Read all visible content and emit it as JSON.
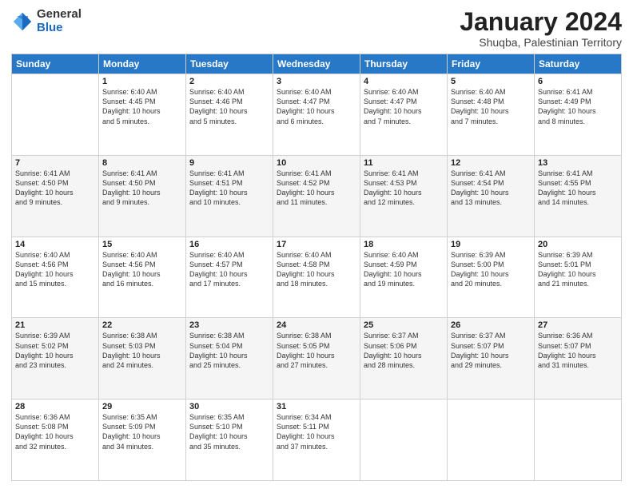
{
  "logo": {
    "general": "General",
    "blue": "Blue"
  },
  "title": "January 2024",
  "subtitle": "Shuqba, Palestinian Territory",
  "columns": [
    "Sunday",
    "Monday",
    "Tuesday",
    "Wednesday",
    "Thursday",
    "Friday",
    "Saturday"
  ],
  "weeks": [
    [
      {
        "day": "",
        "info": ""
      },
      {
        "day": "1",
        "info": "Sunrise: 6:40 AM\nSunset: 4:45 PM\nDaylight: 10 hours\nand 5 minutes."
      },
      {
        "day": "2",
        "info": "Sunrise: 6:40 AM\nSunset: 4:46 PM\nDaylight: 10 hours\nand 5 minutes."
      },
      {
        "day": "3",
        "info": "Sunrise: 6:40 AM\nSunset: 4:47 PM\nDaylight: 10 hours\nand 6 minutes."
      },
      {
        "day": "4",
        "info": "Sunrise: 6:40 AM\nSunset: 4:47 PM\nDaylight: 10 hours\nand 7 minutes."
      },
      {
        "day": "5",
        "info": "Sunrise: 6:40 AM\nSunset: 4:48 PM\nDaylight: 10 hours\nand 7 minutes."
      },
      {
        "day": "6",
        "info": "Sunrise: 6:41 AM\nSunset: 4:49 PM\nDaylight: 10 hours\nand 8 minutes."
      }
    ],
    [
      {
        "day": "7",
        "info": ""
      },
      {
        "day": "8",
        "info": "Sunrise: 6:41 AM\nSunset: 4:50 PM\nDaylight: 10 hours\nand 9 minutes."
      },
      {
        "day": "9",
        "info": "Sunrise: 6:41 AM\nSunset: 4:51 PM\nDaylight: 10 hours\nand 10 minutes."
      },
      {
        "day": "10",
        "info": "Sunrise: 6:41 AM\nSunset: 4:52 PM\nDaylight: 10 hours\nand 11 minutes."
      },
      {
        "day": "11",
        "info": "Sunrise: 6:41 AM\nSunset: 4:53 PM\nDaylight: 10 hours\nand 12 minutes."
      },
      {
        "day": "12",
        "info": "Sunrise: 6:41 AM\nSunset: 4:54 PM\nDaylight: 10 hours\nand 13 minutes."
      },
      {
        "day": "13",
        "info": "Sunrise: 6:41 AM\nSunset: 4:55 PM\nDaylight: 10 hours\nand 14 minutes."
      }
    ],
    [
      {
        "day": "14",
        "info": ""
      },
      {
        "day": "15",
        "info": "Sunrise: 6:40 AM\nSunset: 4:56 PM\nDaylight: 10 hours\nand 16 minutes."
      },
      {
        "day": "16",
        "info": "Sunrise: 6:40 AM\nSunset: 4:57 PM\nDaylight: 10 hours\nand 17 minutes."
      },
      {
        "day": "17",
        "info": "Sunrise: 6:40 AM\nSunset: 4:58 PM\nDaylight: 10 hours\nand 18 minutes."
      },
      {
        "day": "18",
        "info": "Sunrise: 6:40 AM\nSunset: 4:59 PM\nDaylight: 10 hours\nand 19 minutes."
      },
      {
        "day": "19",
        "info": "Sunrise: 6:39 AM\nSunset: 5:00 PM\nDaylight: 10 hours\nand 20 minutes."
      },
      {
        "day": "20",
        "info": "Sunrise: 6:39 AM\nSunset: 5:01 PM\nDaylight: 10 hours\nand 21 minutes."
      }
    ],
    [
      {
        "day": "21",
        "info": ""
      },
      {
        "day": "22",
        "info": "Sunrise: 6:38 AM\nSunset: 5:03 PM\nDaylight: 10 hours\nand 24 minutes."
      },
      {
        "day": "23",
        "info": "Sunrise: 6:38 AM\nSunset: 5:04 PM\nDaylight: 10 hours\nand 25 minutes."
      },
      {
        "day": "24",
        "info": "Sunrise: 6:38 AM\nSunset: 5:05 PM\nDaylight: 10 hours\nand 27 minutes."
      },
      {
        "day": "25",
        "info": "Sunrise: 6:37 AM\nSunset: 5:06 PM\nDaylight: 10 hours\nand 28 minutes."
      },
      {
        "day": "26",
        "info": "Sunrise: 6:37 AM\nSunset: 5:07 PM\nDaylight: 10 hours\nand 29 minutes."
      },
      {
        "day": "27",
        "info": "Sunrise: 6:36 AM\nSunset: 5:07 PM\nDaylight: 10 hours\nand 31 minutes."
      }
    ],
    [
      {
        "day": "28",
        "info": ""
      },
      {
        "day": "29",
        "info": "Sunrise: 6:35 AM\nSunset: 5:09 PM\nDaylight: 10 hours\nand 34 minutes."
      },
      {
        "day": "30",
        "info": "Sunrise: 6:35 AM\nSunset: 5:10 PM\nDaylight: 10 hours\nand 35 minutes."
      },
      {
        "day": "31",
        "info": "Sunrise: 6:34 AM\nSunset: 5:11 PM\nDaylight: 10 hours\nand 37 minutes."
      },
      {
        "day": "",
        "info": ""
      },
      {
        "day": "",
        "info": ""
      },
      {
        "day": "",
        "info": ""
      }
    ]
  ],
  "week1_day7_info": "Sunrise: 6:41 AM\nSunset: 4:50 PM\nDaylight: 10 hours\nand 9 minutes.",
  "week3_day14_info": "Sunrise: 6:40 AM\nSunset: 4:56 PM\nDaylight: 10 hours\nand 15 minutes.",
  "week4_day21_info": "Sunrise: 6:39 AM\nSunset: 5:02 PM\nDaylight: 10 hours\nand 23 minutes.",
  "week5_day28_info": "Sunrise: 6:36 AM\nSunset: 5:08 PM\nDaylight: 10 hours\nand 32 minutes."
}
